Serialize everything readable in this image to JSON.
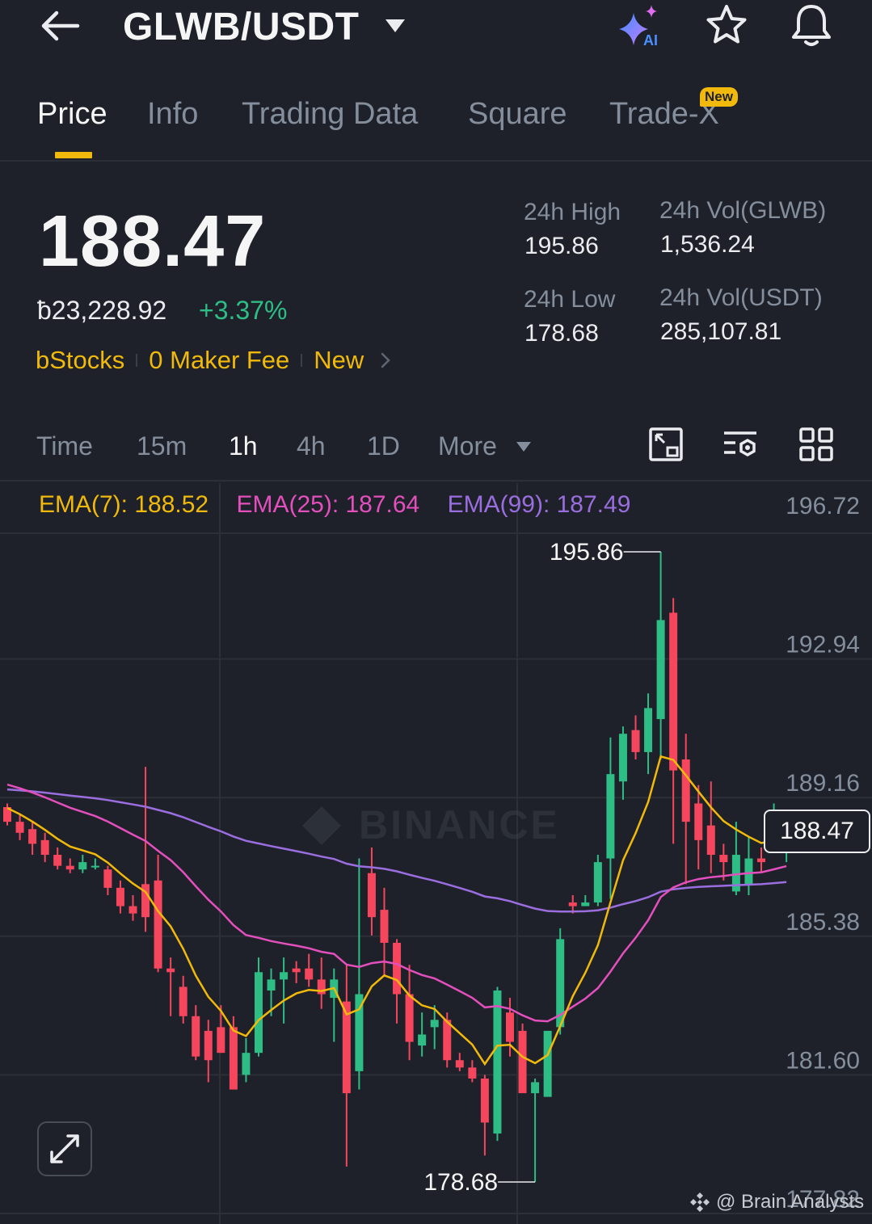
{
  "header": {
    "back_icon": "arrow-left-icon",
    "pair": "GLWB/USDT",
    "ai_label": "AI",
    "star_icon": "star-icon",
    "bell_icon": "bell-icon"
  },
  "tabs": [
    {
      "label": "Price",
      "active": true
    },
    {
      "label": "Info",
      "active": false
    },
    {
      "label": "Trading Data",
      "active": false
    },
    {
      "label": "Square",
      "active": false
    },
    {
      "label": "Trade-X",
      "active": false,
      "badge": "New"
    }
  ],
  "ticker": {
    "last_price": "188.47",
    "fiat_price": "ƀ23,228.92",
    "change": "+3.37%",
    "tags": [
      "bStocks",
      "0 Maker Fee",
      "New"
    ]
  },
  "stats": {
    "high_label": "24h High",
    "high_value": "195.86",
    "low_label": "24h Low",
    "low_value": "178.68",
    "vol_base_label": "24h Vol(GLWB)",
    "vol_base_value": "1,536.24",
    "vol_quote_label": "24h Vol(USDT)",
    "vol_quote_value": "285,107.81"
  },
  "intervals": {
    "items": [
      {
        "label": "Time",
        "active": false
      },
      {
        "label": "15m",
        "active": false
      },
      {
        "label": "1h",
        "active": true
      },
      {
        "label": "4h",
        "active": false
      },
      {
        "label": "1D",
        "active": false
      },
      {
        "label": "More",
        "active": false
      }
    ],
    "tools": [
      "chart-view-icon",
      "indicator-settings-icon",
      "grid-layout-icon"
    ]
  },
  "ema": {
    "ema7": "EMA(7): 188.52",
    "ema25": "EMA(25): 187.64",
    "ema99": "EMA(99): 187.49"
  },
  "colors": {
    "up": "#2ebd85",
    "down": "#f6465d",
    "ema7": "#f0b90b",
    "ema25": "#e34fbc",
    "ema99": "#9b6ee0",
    "accent": "#f0b90b",
    "background": "#1e2129"
  },
  "chart_data": {
    "type": "candlestick",
    "y_ticks": [
      "196.72",
      "192.94",
      "189.16",
      "185.38",
      "181.60",
      "177.82"
    ],
    "ylim": [
      177.82,
      196.72
    ],
    "last_price_tag": "188.47",
    "high_marker": "195.86",
    "low_marker": "178.68",
    "watermark": "BINANCE",
    "candles": [
      [
        188.9,
        188.5,
        189.0,
        188.4
      ],
      [
        188.5,
        188.2,
        188.7,
        188.0
      ],
      [
        188.3,
        187.9,
        188.5,
        187.6
      ],
      [
        188.0,
        187.6,
        188.2,
        187.4
      ],
      [
        187.6,
        187.3,
        187.8,
        187.2
      ],
      [
        187.3,
        187.2,
        187.5,
        187.1
      ],
      [
        187.2,
        187.4,
        187.6,
        187.1
      ],
      [
        187.3,
        187.3,
        187.5,
        187.2
      ],
      [
        187.2,
        186.7,
        187.3,
        186.5
      ],
      [
        186.7,
        186.2,
        186.9,
        186.0
      ],
      [
        186.2,
        186.0,
        186.5,
        185.8
      ],
      [
        186.8,
        185.9,
        190.0,
        185.5
      ],
      [
        186.9,
        184.5,
        187.6,
        184.4
      ],
      [
        184.5,
        184.4,
        184.8,
        183.2
      ],
      [
        184.0,
        183.2,
        184.3,
        183.0
      ],
      [
        183.2,
        182.1,
        183.5,
        182.0
      ],
      [
        182.8,
        182.0,
        183.1,
        181.4
      ],
      [
        182.9,
        182.2,
        183.5,
        182.2
      ],
      [
        182.9,
        181.2,
        183.2,
        181.3
      ],
      [
        181.6,
        182.2,
        182.6,
        181.4
      ],
      [
        182.2,
        184.4,
        184.8,
        182.1
      ],
      [
        183.9,
        184.2,
        184.5,
        183.2
      ],
      [
        184.2,
        184.4,
        184.8,
        183.0
      ],
      [
        184.5,
        184.4,
        184.7,
        184.1
      ],
      [
        184.5,
        184.2,
        184.9,
        184.0
      ],
      [
        184.2,
        183.8,
        184.8,
        183.4
      ],
      [
        183.7,
        184.2,
        184.5,
        182.5
      ],
      [
        183.6,
        181.1,
        184.6,
        179.1
      ],
      [
        181.7,
        183.8,
        187.5,
        181.2
      ],
      [
        187.1,
        185.9,
        187.8,
        185.4
      ],
      [
        186.1,
        185.2,
        186.7,
        184.3
      ],
      [
        185.2,
        183.8,
        185.3,
        183.0
      ],
      [
        183.8,
        182.5,
        184.6,
        182.0
      ],
      [
        182.4,
        182.7,
        183.3,
        182.1
      ],
      [
        182.9,
        183.1,
        183.5,
        182.3
      ],
      [
        183.1,
        182.0,
        183.3,
        181.8
      ],
      [
        182.0,
        181.8,
        182.2,
        181.7
      ],
      [
        181.8,
        181.5,
        182.0,
        181.4
      ],
      [
        181.5,
        180.3,
        181.6,
        179.4
      ],
      [
        180.0,
        183.9,
        184.0,
        179.8
      ],
      [
        183.3,
        182.5,
        183.7,
        182.1
      ],
      [
        182.8,
        181.1,
        183.0,
        181.2
      ],
      [
        181.1,
        181.4,
        181.5,
        178.68
      ],
      [
        181.0,
        182.8,
        182.8,
        181.2
      ],
      [
        182.9,
        185.3,
        185.6,
        182.7
      ],
      [
        186.3,
        186.2,
        186.5,
        186.0
      ],
      [
        186.2,
        186.3,
        186.5,
        186.2
      ],
      [
        186.3,
        187.4,
        187.6,
        186.2
      ],
      [
        187.5,
        189.8,
        190.8,
        186.4
      ],
      [
        189.6,
        190.9,
        191.1,
        189.1
      ],
      [
        191.0,
        190.4,
        191.4,
        190.2
      ],
      [
        190.4,
        191.6,
        192.0,
        189.8
      ],
      [
        191.3,
        194.0,
        195.86,
        190.2
      ],
      [
        194.2,
        189.9,
        194.6,
        187.9
      ],
      [
        190.2,
        188.5,
        190.9,
        186.8
      ],
      [
        189.0,
        188.0,
        189.5,
        187.2
      ],
      [
        188.4,
        187.6,
        189.6,
        187.1
      ],
      [
        187.6,
        187.4,
        187.9,
        186.9
      ],
      [
        186.6,
        187.6,
        188.5,
        186.5
      ],
      [
        186.8,
        187.5,
        188.1,
        186.5
      ],
      [
        187.5,
        187.4,
        187.8,
        187.1
      ],
      [
        187.7,
        188.2,
        189.0,
        187.7
      ],
      [
        187.8,
        188.3,
        188.5,
        187.4
      ]
    ]
  }
}
